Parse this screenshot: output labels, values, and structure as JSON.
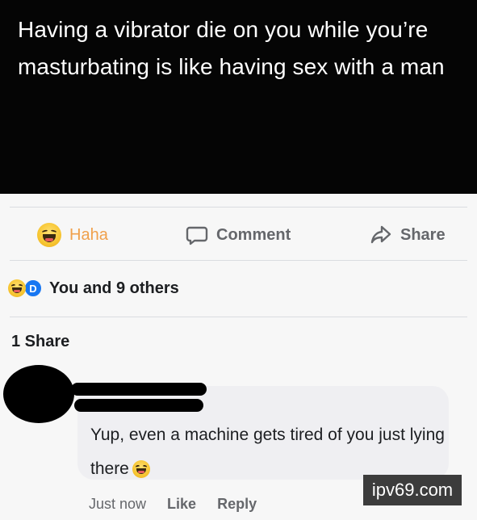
{
  "post": {
    "text": "Having a vibrator die on you while you’re masturbating is like having sex with a man"
  },
  "actions": {
    "haha_label": "Haha",
    "comment_label": "Comment",
    "share_label": "Share",
    "haha_color": "#f0a04b"
  },
  "reactions": {
    "avatar_letter": "D",
    "summary": "You and 9 others"
  },
  "shares": {
    "count_label": "1 Share"
  },
  "comment": {
    "text": "Yup, even a machine gets tired of you just lying there",
    "time": "Just now",
    "like_label": "Like",
    "reply_label": "Reply"
  },
  "watermark": {
    "text": "ipv69.com"
  },
  "icons": {
    "haha": "laughing-emoji-icon",
    "comment": "speech-bubble-icon",
    "share": "share-arrow-icon"
  }
}
